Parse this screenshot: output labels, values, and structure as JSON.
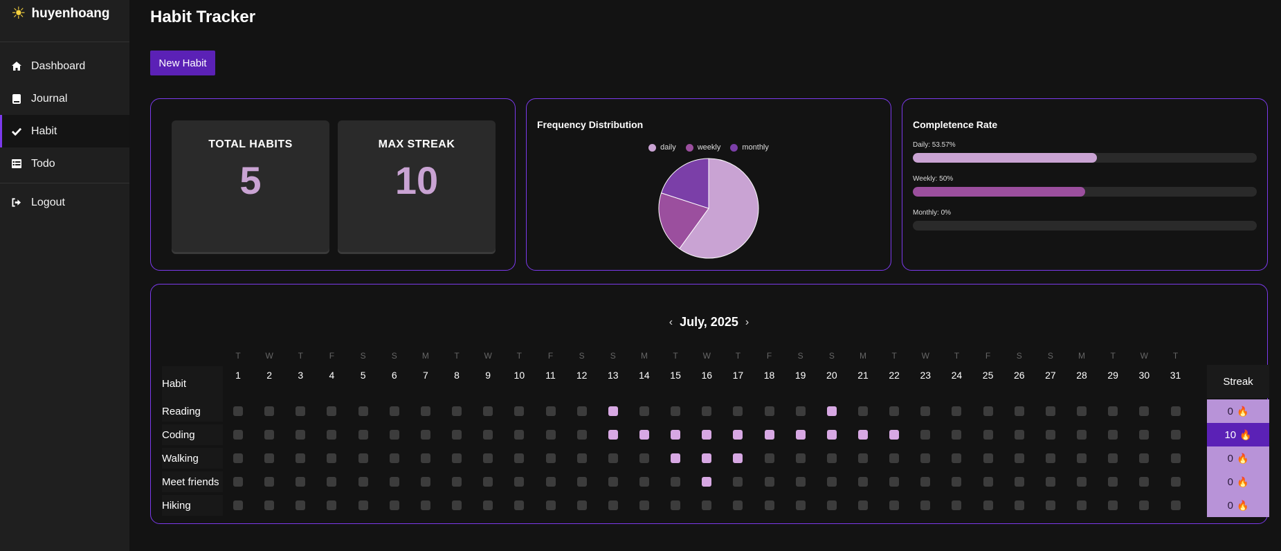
{
  "brand": {
    "name": "huyenhoang",
    "icon": "sun-icon"
  },
  "nav": [
    {
      "label": "Dashboard",
      "icon": "home-icon",
      "active": false
    },
    {
      "label": "Journal",
      "icon": "book-icon",
      "active": false
    },
    {
      "label": "Habit",
      "icon": "check-icon",
      "active": true
    },
    {
      "label": "Todo",
      "icon": "list-icon",
      "active": false
    },
    {
      "label": "Logout",
      "icon": "logout-icon",
      "active": false
    }
  ],
  "page": {
    "title": "Habit Tracker",
    "new_button": "New Habit"
  },
  "stats": {
    "total_label": "TOTAL HABITS",
    "total_value": "5",
    "streak_label": "MAX STREAK",
    "streak_value": "10"
  },
  "frequency": {
    "title": "Frequency Distribution",
    "legend": [
      "daily",
      "weekly",
      "monthly"
    ]
  },
  "completeness": {
    "title": "Completence Rate",
    "rates": [
      {
        "label": "Daily: 53.57%",
        "fraction": 0.5357,
        "color": "#c9a3d3"
      },
      {
        "label": "Weekly: 50%",
        "fraction": 0.5,
        "color": "#9b4f9e"
      },
      {
        "label": "Monthly: 0%",
        "fraction": 0,
        "color": "#7b3fa8"
      }
    ]
  },
  "calendar": {
    "month": "July, 2025",
    "prev": "‹",
    "next": "›",
    "habit_header": "Habit",
    "streak_header": "Streak",
    "day_names": [
      "T",
      "W",
      "T",
      "F",
      "S",
      "S",
      "M",
      "T",
      "W",
      "T",
      "F",
      "S",
      "S",
      "M",
      "T",
      "W",
      "T",
      "F",
      "S",
      "S",
      "M",
      "T",
      "W",
      "T",
      "F",
      "S",
      "S",
      "M",
      "T",
      "W",
      "T"
    ],
    "days": [
      "1",
      "2",
      "3",
      "4",
      "5",
      "6",
      "7",
      "8",
      "9",
      "10",
      "11",
      "12",
      "13",
      "14",
      "15",
      "16",
      "17",
      "18",
      "19",
      "20",
      "21",
      "22",
      "23",
      "24",
      "25",
      "26",
      "27",
      "28",
      "29",
      "30",
      "31"
    ],
    "habits": [
      {
        "name": "Reading",
        "done": [
          13,
          20
        ],
        "streak": "0",
        "top": false
      },
      {
        "name": "Coding",
        "done": [
          13,
          14,
          15,
          16,
          17,
          18,
          19,
          20,
          21,
          22
        ],
        "streak": "10",
        "top": true
      },
      {
        "name": "Walking",
        "done": [
          15,
          16,
          17
        ],
        "streak": "0",
        "top": false
      },
      {
        "name": "Meet friends",
        "done": [
          16
        ],
        "streak": "0",
        "top": false
      },
      {
        "name": "Hiking",
        "done": [],
        "streak": "0",
        "top": false
      }
    ]
  },
  "chart_data": {
    "type": "pie",
    "title": "Frequency Distribution",
    "categories": [
      "daily",
      "weekly",
      "monthly"
    ],
    "values": [
      3,
      1,
      1
    ],
    "colors": [
      "#c9a3d3",
      "#9b4f9e",
      "#7b3fa8"
    ],
    "legend_position": "top"
  }
}
